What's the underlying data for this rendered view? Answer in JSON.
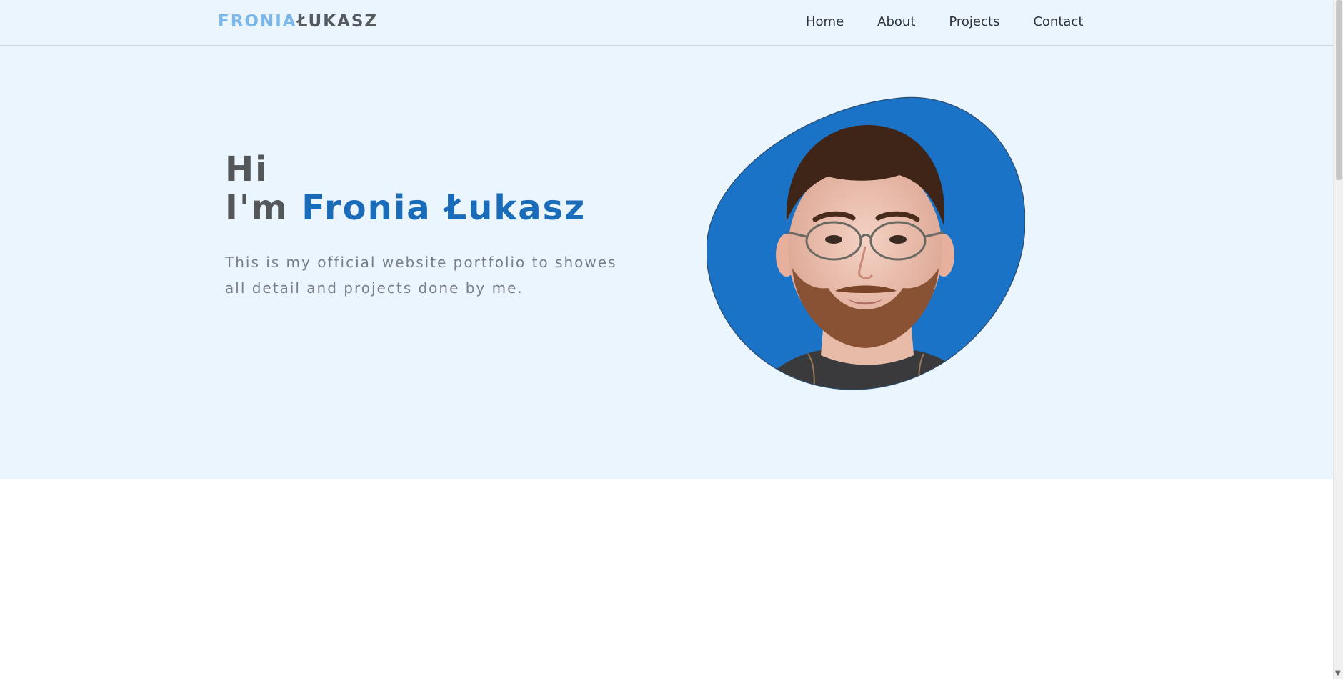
{
  "navbar": {
    "logo_first": "FRONIA",
    "logo_last": "ŁUKASZ",
    "links": [
      {
        "label": "Home"
      },
      {
        "label": "About"
      },
      {
        "label": "Projects"
      },
      {
        "label": "Contact"
      }
    ]
  },
  "hero": {
    "greeting_line1": "Hi",
    "greeting_prefix": "I'm ",
    "name": "Fronia Łukasz",
    "tagline": "This is my official website portfolio to showes all detail and projects done by me."
  },
  "icons": {
    "scroll_down": "chevron-down-icon"
  },
  "colors": {
    "hero_bg": "#ebf5fd",
    "accent": "#1a6bb8",
    "logo_accent": "#7ab8ec",
    "blob": "#1a73c6"
  }
}
